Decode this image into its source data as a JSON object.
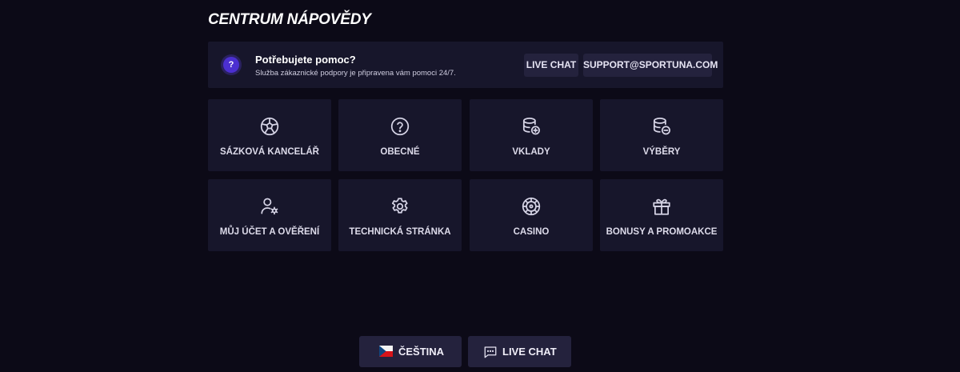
{
  "page": {
    "title": "CENTRUM NÁPOVĚDY"
  },
  "help": {
    "title": "Potřebujete pomoc?",
    "subtitle": "Služba zákaznické podpory je připravena vám pomoci 24/7.",
    "badge": "?",
    "live_chat_label": "LIVE CHAT",
    "email_label": "SUPPORT@SPORTUNA.COM"
  },
  "categories": [
    {
      "label": "SÁZKOVÁ KANCELÁŘ",
      "icon": "soccer-ball-icon"
    },
    {
      "label": "OBECNÉ",
      "icon": "question-circle-icon"
    },
    {
      "label": "VKLADY",
      "icon": "coins-plus-icon"
    },
    {
      "label": "VÝBĚRY",
      "icon": "coins-minus-icon"
    },
    {
      "label": "MŮJ ÚČET A OVĚŘENÍ",
      "icon": "user-settings-icon"
    },
    {
      "label": "TECHNICKÁ STRÁNKA",
      "icon": "gear-icon"
    },
    {
      "label": "CASINO",
      "icon": "roulette-icon"
    },
    {
      "label": "BONUSY A PROMOAKCE",
      "icon": "gift-icon"
    }
  ],
  "footer": {
    "language_label": "ČEŠTINA",
    "language_icon": "czech-flag-icon",
    "live_chat_label": "LIVE CHAT",
    "live_chat_icon": "chat-bubble-icon"
  },
  "colors": {
    "background": "#0c0a17",
    "card": "#17162b",
    "button": "#24223d",
    "accent": "#4b2fd1"
  }
}
